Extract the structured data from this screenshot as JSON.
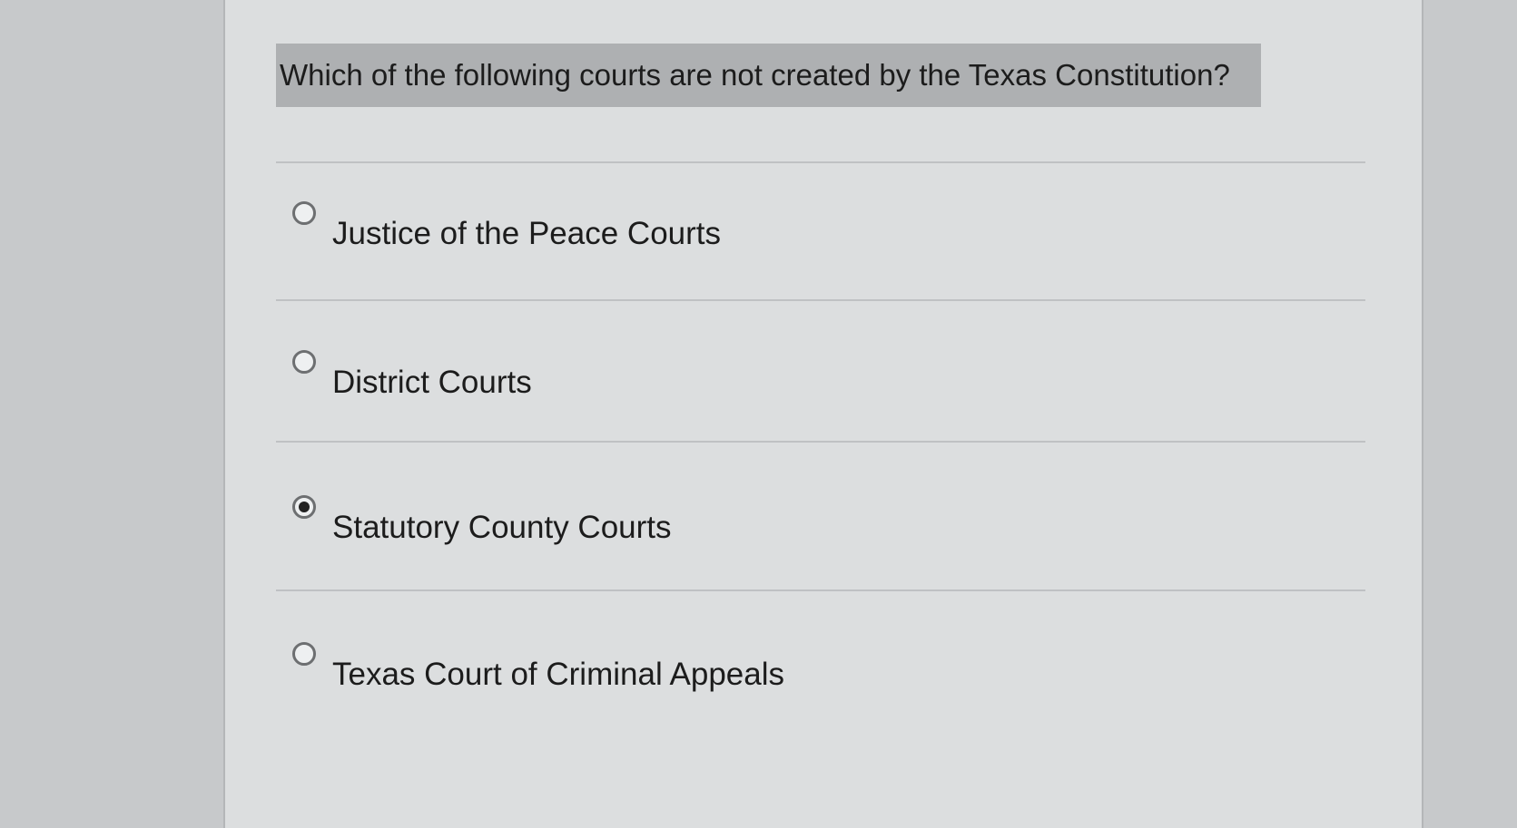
{
  "question": {
    "text": "Which of the following courts are not created by the Texas Constitution?"
  },
  "answers": [
    {
      "label": "Justice of the Peace Courts",
      "selected": false
    },
    {
      "label": "District Courts",
      "selected": false
    },
    {
      "label": "Statutory County Courts",
      "selected": true
    },
    {
      "label": "Texas Court of Criminal Appeals",
      "selected": false
    }
  ]
}
